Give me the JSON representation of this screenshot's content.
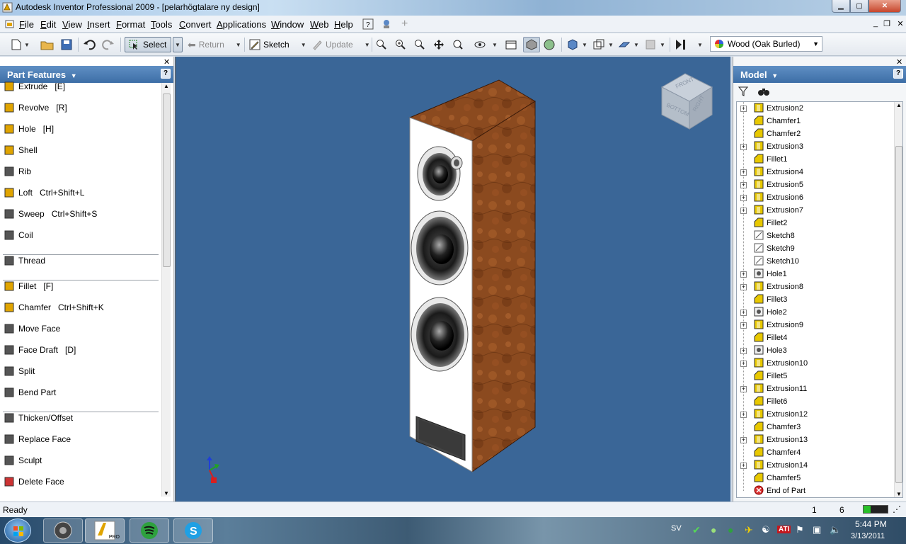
{
  "window": {
    "title": "Autodesk Inventor Professional 2009 - [pelarhögtalare ny design]",
    "min_symbol": "▁",
    "max_symbol": "▢",
    "close_symbol": "✕"
  },
  "menu": {
    "items": [
      "File",
      "Edit",
      "View",
      "Insert",
      "Format",
      "Tools",
      "Convert",
      "Applications",
      "Window",
      "Web",
      "Help"
    ],
    "mdi_min": "_",
    "mdi_restore": "❐",
    "mdi_close": "✕"
  },
  "toolbar": {
    "select_label": "Select",
    "return_label": "Return",
    "sketch_label": "Sketch",
    "update_label": "Update",
    "material": "Wood (Oak Burled)"
  },
  "left_panel": {
    "title": "Part Features",
    "help": "?",
    "close": "✕",
    "features": [
      {
        "label": "Extrude",
        "shortcut": "[E]",
        "icon": "extrude-icon"
      },
      {
        "label": "Revolve",
        "shortcut": "[R]",
        "icon": "revolve-icon"
      },
      {
        "label": "Hole",
        "shortcut": "[H]",
        "icon": "hole-icon"
      },
      {
        "label": "Shell",
        "shortcut": "",
        "icon": "shell-icon"
      },
      {
        "label": "Rib",
        "shortcut": "",
        "icon": "rib-icon"
      },
      {
        "label": "Loft",
        "shortcut": "Ctrl+Shift+L",
        "icon": "loft-icon"
      },
      {
        "label": "Sweep",
        "shortcut": "Ctrl+Shift+S",
        "icon": "sweep-icon"
      },
      {
        "label": "Coil",
        "shortcut": "",
        "icon": "coil-icon"
      },
      {
        "label": "Thread",
        "shortcut": "",
        "icon": "thread-icon"
      },
      {
        "label": "Fillet",
        "shortcut": "[F]",
        "icon": "fillet-icon"
      },
      {
        "label": "Chamfer",
        "shortcut": "Ctrl+Shift+K",
        "icon": "chamfer-icon"
      },
      {
        "label": "Move Face",
        "shortcut": "",
        "icon": "move-face-icon"
      },
      {
        "label": "Face Draft",
        "shortcut": "[D]",
        "icon": "face-draft-icon"
      },
      {
        "label": "Split",
        "shortcut": "",
        "icon": "split-icon"
      },
      {
        "label": "Bend Part",
        "shortcut": "",
        "icon": "bend-part-icon"
      },
      {
        "label": "Thicken/Offset",
        "shortcut": "",
        "icon": "thicken-icon"
      },
      {
        "label": "Replace Face",
        "shortcut": "",
        "icon": "replace-face-icon"
      },
      {
        "label": "Sculpt",
        "shortcut": "",
        "icon": "sculpt-icon"
      },
      {
        "label": "Delete Face",
        "shortcut": "",
        "icon": "delete-face-icon"
      }
    ]
  },
  "viewport": {
    "viewcube_front": "FRONT",
    "viewcube_right": "RIGHT",
    "viewcube_bottom": "BOTTOM",
    "bg_color": "#3a6697",
    "wood_color": "#8b4a1f"
  },
  "right_panel": {
    "title": "Model",
    "help": "?",
    "close": "✕",
    "tree": [
      {
        "label": "Extrusion2",
        "type": "extrusion",
        "expandable": true
      },
      {
        "label": "Chamfer1",
        "type": "chamfer",
        "expandable": false
      },
      {
        "label": "Chamfer2",
        "type": "chamfer",
        "expandable": false
      },
      {
        "label": "Extrusion3",
        "type": "extrusion",
        "expandable": true
      },
      {
        "label": "Fillet1",
        "type": "fillet",
        "expandable": false
      },
      {
        "label": "Extrusion4",
        "type": "extrusion",
        "expandable": true
      },
      {
        "label": "Extrusion5",
        "type": "extrusion",
        "expandable": true
      },
      {
        "label": "Extrusion6",
        "type": "extrusion",
        "expandable": true
      },
      {
        "label": "Extrusion7",
        "type": "extrusion",
        "expandable": true
      },
      {
        "label": "Fillet2",
        "type": "fillet",
        "expandable": false
      },
      {
        "label": "Sketch8",
        "type": "sketch",
        "expandable": false
      },
      {
        "label": "Sketch9",
        "type": "sketch",
        "expandable": false
      },
      {
        "label": "Sketch10",
        "type": "sketch",
        "expandable": false
      },
      {
        "label": "Hole1",
        "type": "hole",
        "expandable": true
      },
      {
        "label": "Extrusion8",
        "type": "extrusion",
        "expandable": true
      },
      {
        "label": "Fillet3",
        "type": "fillet",
        "expandable": false
      },
      {
        "label": "Hole2",
        "type": "hole",
        "expandable": true
      },
      {
        "label": "Extrusion9",
        "type": "extrusion",
        "expandable": true
      },
      {
        "label": "Fillet4",
        "type": "fillet",
        "expandable": false
      },
      {
        "label": "Hole3",
        "type": "hole",
        "expandable": true
      },
      {
        "label": "Extrusion10",
        "type": "extrusion",
        "expandable": true
      },
      {
        "label": "Fillet5",
        "type": "fillet",
        "expandable": false
      },
      {
        "label": "Extrusion11",
        "type": "extrusion",
        "expandable": true
      },
      {
        "label": "Fillet6",
        "type": "fillet",
        "expandable": false
      },
      {
        "label": "Extrusion12",
        "type": "extrusion",
        "expandable": true
      },
      {
        "label": "Chamfer3",
        "type": "chamfer",
        "expandable": false
      },
      {
        "label": "Extrusion13",
        "type": "extrusion",
        "expandable": true
      },
      {
        "label": "Chamfer4",
        "type": "chamfer",
        "expandable": false
      },
      {
        "label": "Extrusion14",
        "type": "extrusion",
        "expandable": true
      },
      {
        "label": "Chamfer5",
        "type": "chamfer",
        "expandable": false
      },
      {
        "label": "End of Part",
        "type": "end",
        "expandable": false
      }
    ]
  },
  "status": {
    "text": "Ready",
    "count1": "1",
    "count2": "6"
  },
  "taskbar": {
    "lang": "SV",
    "time": "5:44 PM",
    "date": "3/13/2011",
    "pro_label": "PRO"
  }
}
